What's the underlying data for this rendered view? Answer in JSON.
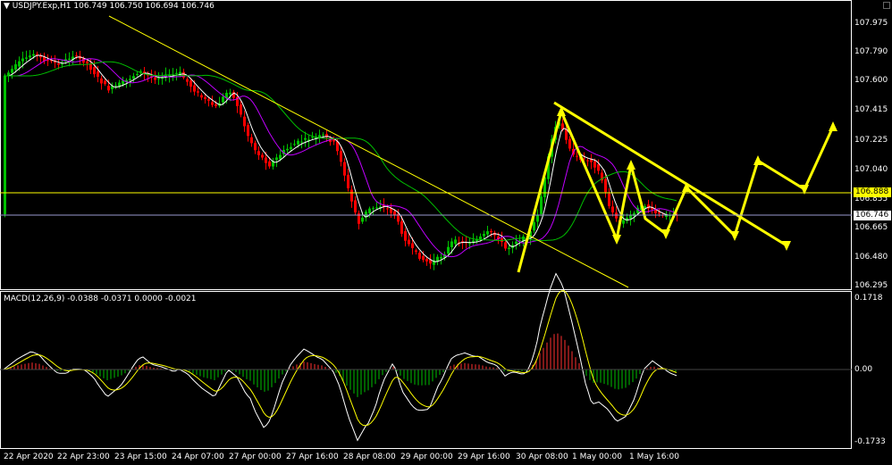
{
  "chart": {
    "symbol_line": "USDJPY.Exp,H1  106.749 106.750 106.694 106.746",
    "macd_line": "MACD(12,26,9) -0.0388 -0.0371 0.0000 -0.0021",
    "price_ticks": [
      "107.975",
      "107.790",
      "107.600",
      "107.415",
      "107.225",
      "107.040",
      "106.855",
      "106.665",
      "106.480",
      "106.295"
    ],
    "macd_ticks": [
      "0.1718",
      "0.00",
      "-0.1733"
    ],
    "time_ticks": [
      "22 Apr 2020",
      "22 Apr 23:00",
      "23 Apr 15:00",
      "24 Apr 07:00",
      "27 Apr 00:00",
      "27 Apr 16:00",
      "28 Apr 08:00",
      "29 Apr 00:00",
      "29 Apr 16:00",
      "30 Apr 08:00",
      "1 May 00:00",
      "1 May 16:00"
    ],
    "hline_price": "106.888",
    "last_price": "106.746",
    "colors": {
      "bull": "#00c000",
      "bear": "#ff0000",
      "drawing": "#ffff00",
      "ma_fast": "#ffffff",
      "ma_mid": "#c000ff",
      "ma_slow": "#00c000"
    }
  }
}
